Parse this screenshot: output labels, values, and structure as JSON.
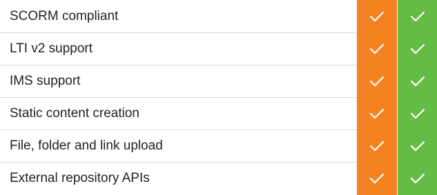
{
  "colors": {
    "column_a": "#f58220",
    "column_b": "#64bc46",
    "check": "#ffffff",
    "divider": "#d9d9d9",
    "text": "#1f1f1f"
  },
  "rows": [
    {
      "label": "SCORM compliant",
      "col_a": "check-icon",
      "col_b": "check-icon"
    },
    {
      "label": "LTI v2 support",
      "col_a": "check-icon",
      "col_b": "check-icon"
    },
    {
      "label": "IMS support",
      "col_a": "check-icon",
      "col_b": "check-icon"
    },
    {
      "label": "Static content creation",
      "col_a": "check-icon",
      "col_b": "check-icon"
    },
    {
      "label": "File, folder and link upload",
      "col_a": "check-icon",
      "col_b": "check-icon"
    },
    {
      "label": "External repository APIs",
      "col_a": "check-icon",
      "col_b": "check-icon"
    }
  ]
}
